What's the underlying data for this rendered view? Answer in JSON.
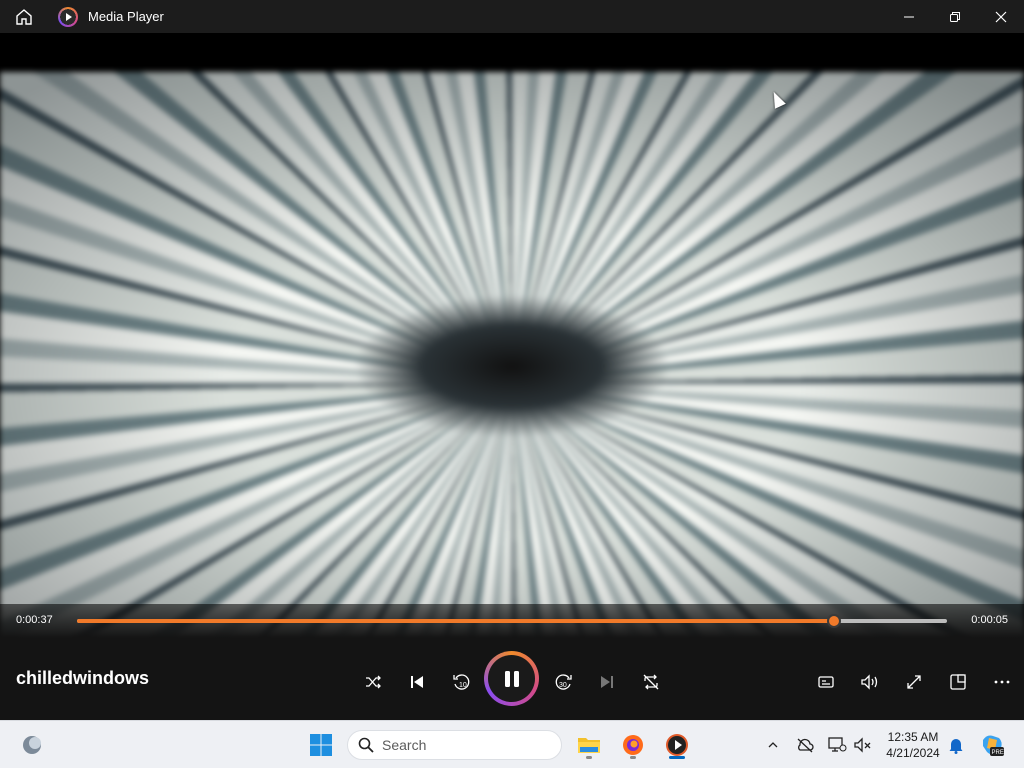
{
  "window": {
    "title": "Media Player"
  },
  "player": {
    "current_time": "0:00:37",
    "duration": "0:00:05",
    "progress_fraction": 0.87,
    "track_title": "chilledwindows"
  },
  "taskbar": {
    "search_placeholder": "Search",
    "time": "12:35 AM",
    "date": "4/21/2024"
  },
  "colors": {
    "accent": "#f07a2a",
    "titlebar": "#1c1c1c",
    "taskbar": "#eef0f4"
  }
}
